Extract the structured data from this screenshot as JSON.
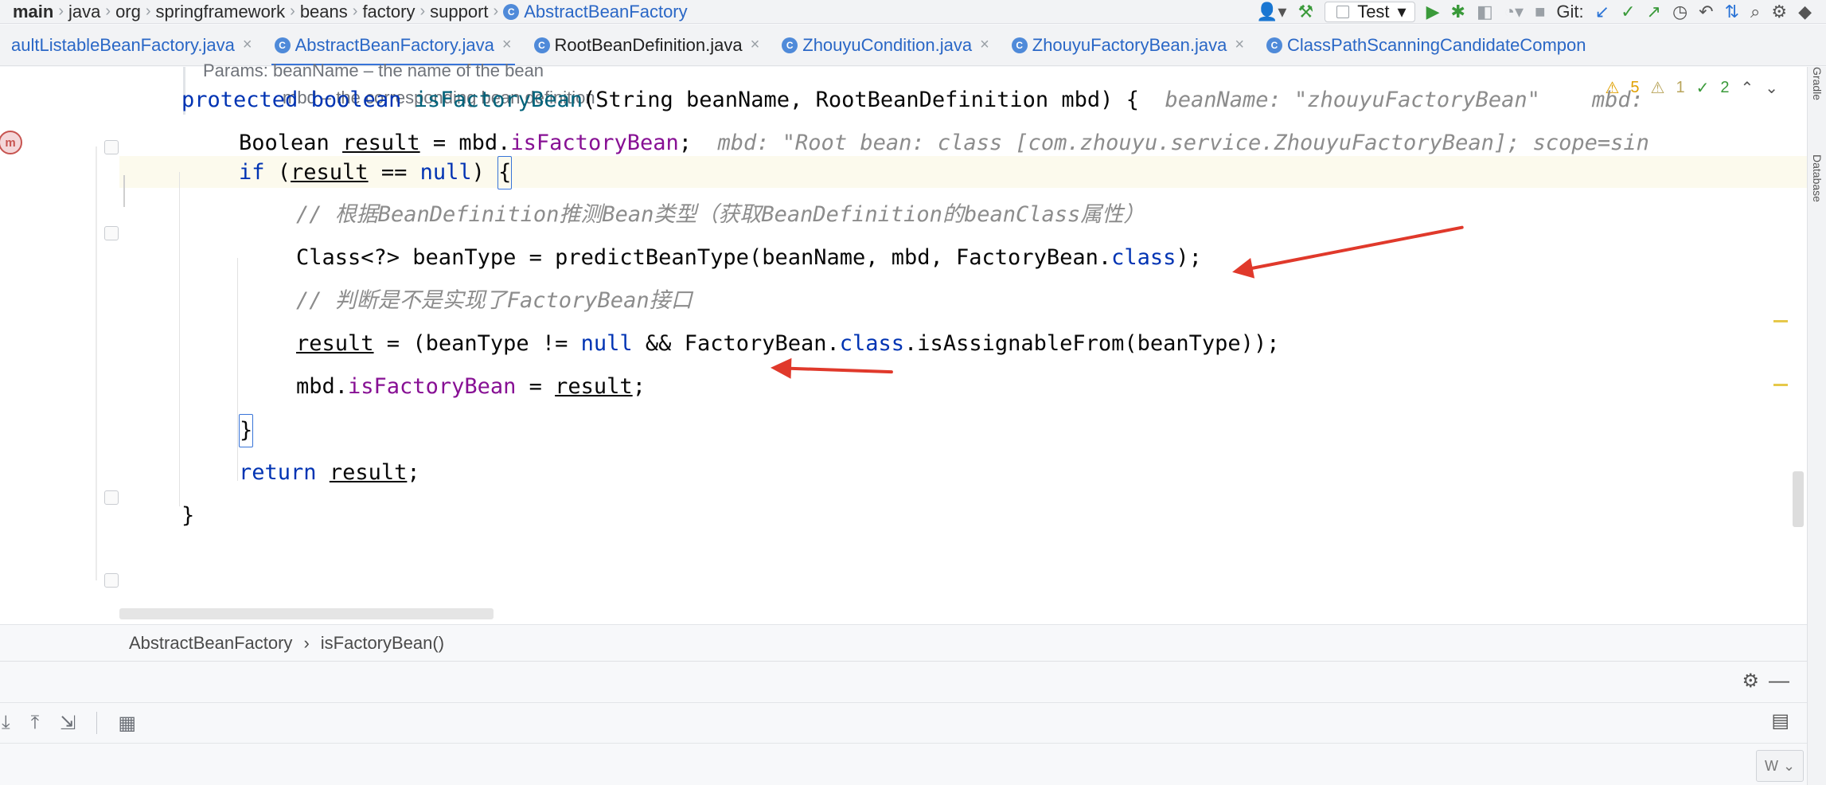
{
  "breadcrumb": {
    "items": [
      "main",
      "java",
      "org",
      "springframework",
      "beans",
      "factory",
      "support"
    ],
    "class_name": "AbstractBeanFactory"
  },
  "toolbar": {
    "run_config": "Test",
    "git_label": "Git:"
  },
  "tabs": [
    {
      "label": "aultListableBeanFactory.java",
      "active": false
    },
    {
      "label": "AbstractBeanFactory.java",
      "active": true
    },
    {
      "label": "RootBeanDefinition.java",
      "active": false
    },
    {
      "label": "ZhouyuCondition.java",
      "active": false
    },
    {
      "label": "ZhouyuFactoryBean.java",
      "active": false
    },
    {
      "label": "ClassPathScanningCandidateCompon",
      "active": false
    }
  ],
  "editor": {
    "doc": {
      "line1": "Params: beanName – the name of the bean",
      "line2": "mbd – the corresponding bean definition"
    },
    "inspections": {
      "warnings": "5",
      "weak_warnings": "1",
      "typos": "2"
    },
    "code": {
      "l1": {
        "kw1": "protected",
        "kw2": "boolean",
        "fn": "isFactoryBean",
        "params": "(String beanName, RootBeanDefinition mbd) {",
        "hint": "beanName: \"zhouyuFactoryBean\"    mbd:"
      },
      "l2": {
        "type": "Boolean",
        "var": "result",
        "eq": " = mbd.",
        "field": "isFactoryBean",
        "end": ";",
        "hint": "mbd: \"Root bean: class [com.zhouyu.service.ZhouyuFactoryBean]; scope=sin"
      },
      "l3": {
        "kw": "if",
        "open": " (",
        "var": "result",
        "mid": " == ",
        "null": "null",
        "close": ") ",
        "brace": "{"
      },
      "l4": {
        "comment": "// 根据BeanDefinition推测Bean类型（获取BeanDefinition的beanClass属性）"
      },
      "l5": {
        "text1": "Class<?> beanType = ",
        "fn": "predictBeanType",
        "text2": "(beanName, mbd, FactoryBean.",
        "kw": "class",
        "text3": ");"
      },
      "l6": {
        "comment": "// 判断是不是实现了FactoryBean接口"
      },
      "l7": {
        "var": "result",
        "text1": " = (beanType != ",
        "null": "null",
        "text2": " && FactoryBean.",
        "kw": "class",
        "text3": ".isAssignableFrom(beanType));"
      },
      "l8": {
        "text1": "mbd.",
        "field": "isFactoryBean",
        "text2": " = ",
        "var": "result",
        "text3": ";"
      },
      "l9": {
        "brace": "}"
      },
      "l10": {
        "kw": "return",
        "sp": " ",
        "var": "result",
        "end": ";"
      },
      "l11": {
        "brace": "}"
      }
    }
  },
  "footer_breadcrumb": {
    "class": "AbstractBeanFactory",
    "method": "isFactoryBean()"
  },
  "right_strip": {
    "gradle": "Gradle",
    "database": "Database"
  },
  "bottom_panel": {
    "select_value": "W"
  },
  "colors": {
    "arrow": "#e0392b",
    "accent": "#3874d8",
    "keyword": "#0033b3",
    "field": "#871094"
  }
}
